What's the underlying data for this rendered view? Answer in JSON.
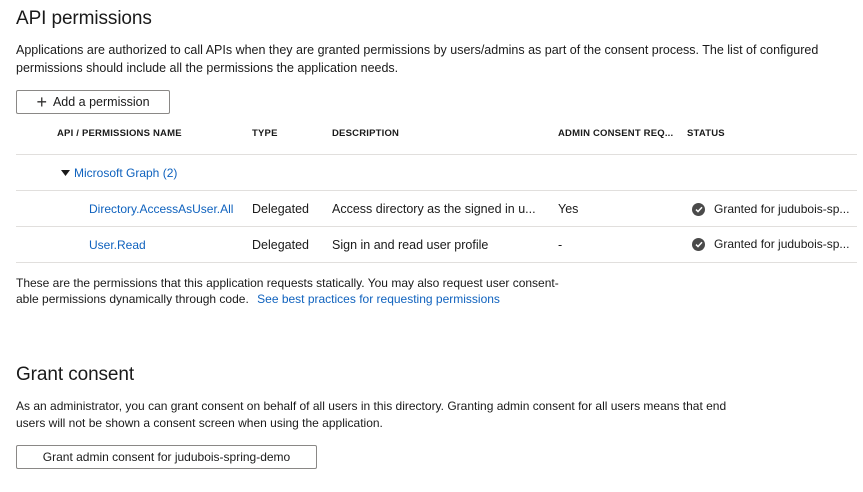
{
  "page": {
    "title": "API permissions",
    "intro_line1": "Applications are authorized to call APIs when they are granted permissions by users/admins as part of the consent process. The list of configured",
    "intro_line2": "permissions should include all the permissions the application needs."
  },
  "toolbar": {
    "add_permission_label": "Add a permission",
    "add_icon": "plus-icon"
  },
  "table": {
    "columns": [
      "API / PERMISSIONS NAME",
      "TYPE",
      "DESCRIPTION",
      "ADMIN CONSENT REQ...",
      "STATUS"
    ],
    "group": {
      "label": "Microsoft Graph (2)",
      "icon": "caret-down-icon"
    },
    "rows": [
      {
        "name": "Directory.AccessAsUser.All",
        "type": "Delegated",
        "description": "Access directory as the signed in u...",
        "admin_consent": "Yes",
        "status": "Granted for judubois-sp..."
      },
      {
        "name": "User.Read",
        "type": "Delegated",
        "description": "Sign in and read user profile",
        "admin_consent": "-",
        "status": "Granted for judubois-sp..."
      }
    ],
    "status_icon": "check-circle-icon"
  },
  "footer_note": {
    "line1": "These are the permissions that this application requests statically. You may also request user consent-",
    "line2": "able permissions dynamically through code.",
    "link": "See best practices for requesting permissions"
  },
  "grant": {
    "title": "Grant consent",
    "line1": "As an administrator, you can grant consent on behalf of all users in this directory. Granting admin consent for all users means that end",
    "line2": "users will not be shown a consent screen when using the application.",
    "button_label": "Grant admin consent for judubois-spring-demo"
  },
  "colors": {
    "link": "#0f62be",
    "border": "#e1dfdd",
    "text": "#1a1a1a"
  }
}
